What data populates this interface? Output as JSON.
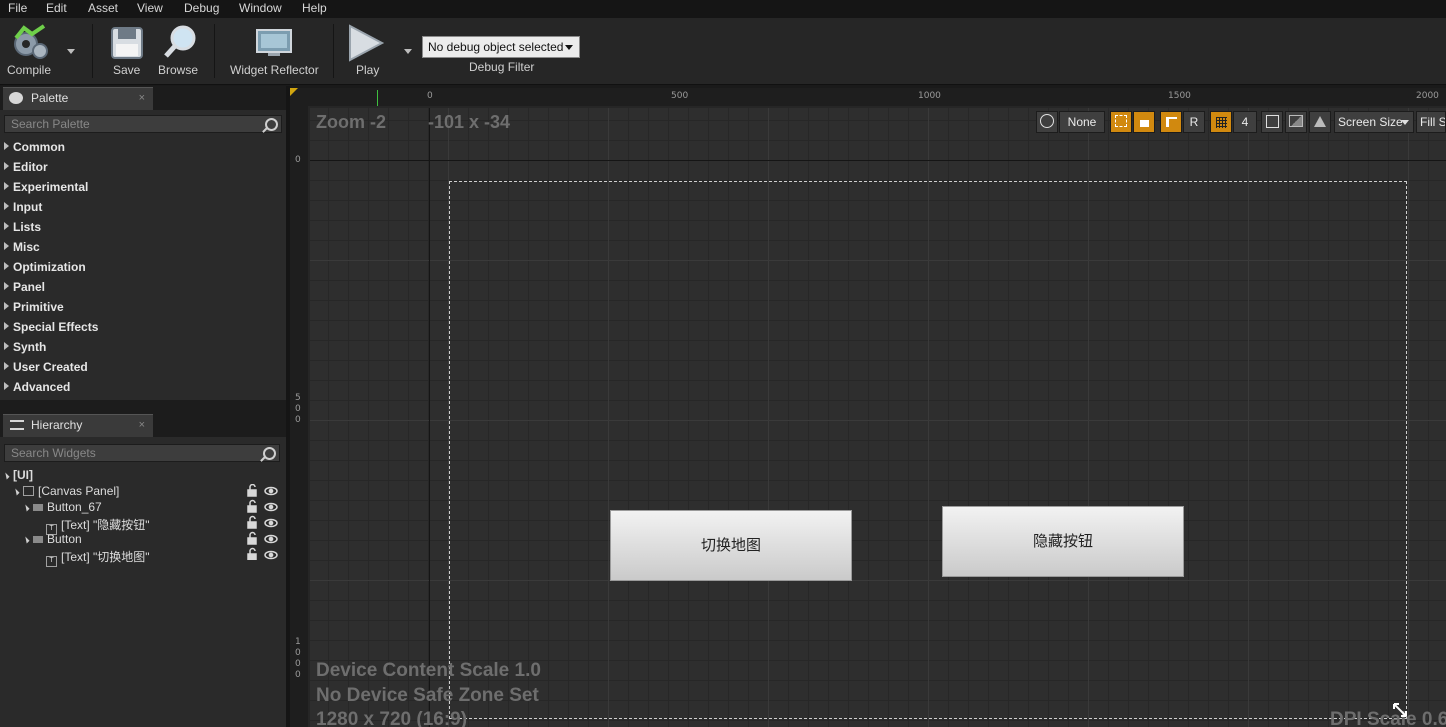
{
  "menu": [
    "File",
    "Edit",
    "Asset",
    "View",
    "Debug",
    "Window",
    "Help"
  ],
  "toolbar": {
    "compile": "Compile",
    "save": "Save",
    "browse": "Browse",
    "widget_reflector": "Widget Reflector",
    "play": "Play",
    "debug_select_value": "No debug object selected",
    "debug_filter": "Debug Filter"
  },
  "palette": {
    "tab": "Palette",
    "close": "×",
    "search_placeholder": "Search Palette",
    "categories": [
      "Common",
      "Editor",
      "Experimental",
      "Input",
      "Lists",
      "Misc",
      "Optimization",
      "Panel",
      "Primitive",
      "Special Effects",
      "Synth",
      "User Created",
      "Advanced"
    ]
  },
  "hierarchy": {
    "tab": "Hierarchy",
    "close": "×",
    "search_placeholder": "Search Widgets",
    "rows": [
      "[UI]",
      "[Canvas Panel]",
      "Button_67",
      "[Text] \"隐藏按钮\"",
      "Button",
      "[Text] \"切换地图\""
    ]
  },
  "designer": {
    "ruler_top": [
      "0",
      "500",
      "1000",
      "1500",
      "2000"
    ],
    "ruler_left": [
      [
        "0"
      ],
      [
        "5",
        "0",
        "0"
      ],
      [
        "1",
        "0",
        "0",
        "0"
      ]
    ],
    "zoom": "Zoom -2",
    "cursor": "-101 x -34",
    "toolbar": {
      "none": "None",
      "r": "R",
      "grid_size": "4",
      "screen_size": "Screen Size",
      "fill": "Fill Sc"
    },
    "info_lines": [
      "Device Content Scale 1.0",
      "No Device Safe Zone Set",
      "1280 x 720 (16:9)"
    ],
    "dpi": "DPI Scale 0.6",
    "buttons": [
      "切换地图",
      "隐藏按钮"
    ]
  },
  "colors": {
    "accent": "#d1890f",
    "bg": "#262626"
  }
}
